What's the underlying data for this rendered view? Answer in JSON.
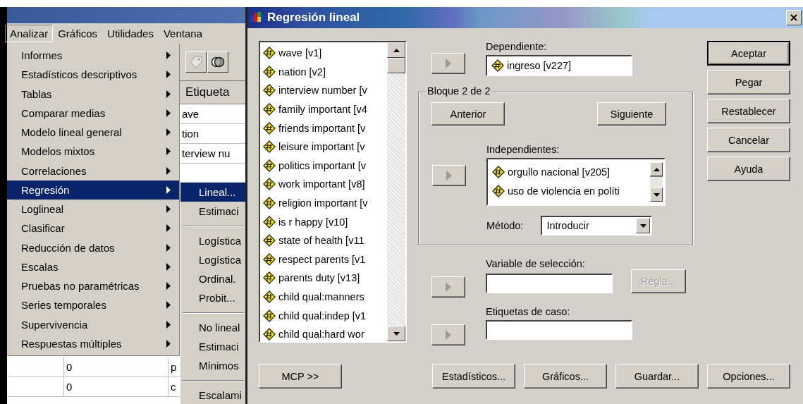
{
  "background_window": {
    "menu_bar": [
      {
        "label": "Analizar",
        "selected": true
      },
      {
        "label": "Gráficos",
        "selected": false
      },
      {
        "label": "Utilidades",
        "selected": false
      },
      {
        "label": "Ventana",
        "selected": false
      }
    ],
    "column_header": "Etiqueta",
    "label_cells": [
      "ave",
      "tion",
      "terview nu"
    ],
    "bottom_rows": [
      [
        "0",
        "p"
      ],
      [
        "0",
        "c"
      ]
    ]
  },
  "analyze_menu": {
    "items": [
      {
        "label": "Informes",
        "submenu": true,
        "selected": false
      },
      {
        "label": "Estadísticos descriptivos",
        "submenu": true,
        "selected": false
      },
      {
        "label": "Tablas",
        "submenu": true,
        "selected": false
      },
      {
        "label": "Comparar medias",
        "submenu": true,
        "selected": false
      },
      {
        "label": "Modelo lineal general",
        "submenu": true,
        "selected": false
      },
      {
        "label": "Modelos mixtos",
        "submenu": true,
        "selected": false
      },
      {
        "label": "Correlaciones",
        "submenu": true,
        "selected": false
      },
      {
        "label": "Regresión",
        "submenu": true,
        "selected": true
      },
      {
        "label": "Loglineal",
        "submenu": true,
        "selected": false
      },
      {
        "label": "Clasificar",
        "submenu": true,
        "selected": false
      },
      {
        "label": "Reducción de datos",
        "submenu": true,
        "selected": false
      },
      {
        "label": "Escalas",
        "submenu": true,
        "selected": false
      },
      {
        "label": "Pruebas no paramétricas",
        "submenu": true,
        "selected": false
      },
      {
        "label": "Series temporales",
        "submenu": true,
        "selected": false
      },
      {
        "label": "Supervivencia",
        "submenu": true,
        "selected": false
      },
      {
        "label": "Respuestas múltiples",
        "submenu": true,
        "selected": false
      }
    ]
  },
  "regression_submenu": {
    "items": [
      {
        "kind": "item",
        "label": "Lineal...",
        "selected": true
      },
      {
        "kind": "item",
        "label": "Estimaci",
        "selected": false
      },
      {
        "kind": "separator"
      },
      {
        "kind": "item",
        "label": "Logística",
        "selected": false
      },
      {
        "kind": "item",
        "label": "Logística",
        "selected": false
      },
      {
        "kind": "item",
        "label": "Ordinal.",
        "selected": false
      },
      {
        "kind": "item",
        "label": "Probit...",
        "selected": false
      },
      {
        "kind": "separator"
      },
      {
        "kind": "item",
        "label": "No lineal",
        "selected": false
      },
      {
        "kind": "item",
        "label": "Estimaci",
        "selected": false
      },
      {
        "kind": "item",
        "label": "Mínimos",
        "selected": false
      },
      {
        "kind": "separator"
      },
      {
        "kind": "item",
        "label": "Escalami",
        "selected": false
      }
    ]
  },
  "dialog": {
    "title": "Regresión lineal",
    "variables": [
      "wave [v1]",
      "nation [v2]",
      "interview number [v",
      "family important [v4",
      "friends important [v",
      "leisure important [v",
      "politics important [v",
      "work important [v8]",
      "religion important [v",
      "is r happy [v10]",
      "state of health [v11",
      "respect parents [v1",
      "parents duty [v13]",
      "child qual:manners",
      "child qual:indep [v1",
      "child qual:hard wor"
    ],
    "dependent": {
      "label": "Dependiente:",
      "value": "ingreso [v227]"
    },
    "block": {
      "title": "Bloque 2 de 2",
      "previous": "Anterior",
      "next": "Siguiente",
      "independents_label": "Independientes:",
      "independents": [
        "orgullo nacional [v205]",
        "uso de violencia en políti"
      ],
      "method_label": "Método:",
      "method": "Introducir"
    },
    "selection_variable": {
      "label": "Variable de selección:",
      "rule_button": {
        "label": "Regla...",
        "disabled": true
      }
    },
    "case_labels": {
      "label": "Etiquetas de caso:"
    },
    "side_buttons": [
      {
        "label": "Aceptar",
        "default": true
      },
      {
        "label": "Pegar",
        "default": false
      },
      {
        "label": "Restablecer",
        "default": false
      },
      {
        "label": "Cancelar",
        "default": false
      },
      {
        "label": "Ayuda",
        "default": false
      }
    ],
    "mcp_button": "MCP >>",
    "bottom_buttons": [
      "Estadísticos...",
      "Gráficos...",
      "Guardar...",
      "Opciones..."
    ]
  }
}
